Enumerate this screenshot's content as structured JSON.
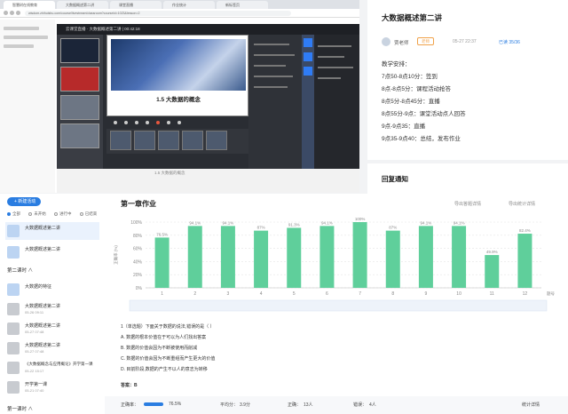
{
  "browser": {
    "tabs": [
      {
        "label": "智慧树在线教育"
      },
      {
        "label": "大数据概述第二讲"
      },
      {
        "label": "课堂直播"
      },
      {
        "label": "作业统计"
      },
      {
        "label": "新标签页"
      }
    ],
    "url": "wisdom.zhihuishu.com/course/livestream/classroom?courseId=1023&lesson=2"
  },
  "player": {
    "header": "云课堂直播 · 大数据概述第二讲 | 00:42:18",
    "slide_title": "1.5 大数据的概念",
    "below_text": "1.5 大数据的概念"
  },
  "notice": {
    "title": "大数据概述第二讲",
    "teacher": "贾老师",
    "badge": "老师",
    "time": "05-27 22:37",
    "read": "已读 35/36",
    "lines": [
      "教学安排：",
      "7点50-8点10分：签到",
      "8点-8点5分：课程活动抢答",
      "8点5分-8点45分：直播",
      "8点55分-9点：课堂活动点人回答",
      "9点-9点35：直播",
      "9点35-9点40：总结，发布作业"
    ],
    "section2": "回复通知"
  },
  "sidebar": {
    "new_button": "+ 新建活动",
    "filters": [
      "全部",
      "未开始",
      "进行中",
      "已结束"
    ],
    "items_top": [
      {
        "title": "大数据概述第二讲",
        "sub": ""
      },
      {
        "title": "大数据概述第二讲",
        "sub": ""
      }
    ],
    "section": "第二课时 ∧",
    "items": [
      {
        "title": "大数据的特征",
        "sub": ""
      },
      {
        "title": "大数据概述第二讲",
        "sub": "05-26 09:11"
      },
      {
        "title": "大数据概述第二讲",
        "sub": "05-27 07:48"
      },
      {
        "title": "大数据概述第二讲",
        "sub": "05-27 07:48"
      },
      {
        "title": "《大数据概念与应用概论》开学第一课",
        "sub": "05-22 15:17"
      },
      {
        "title": "开学第一课",
        "sub": "05-21 07:40"
      }
    ],
    "section_bottom": "第一课时 ∧"
  },
  "homework": {
    "title": "第一章作业",
    "export1": "导出答题详情",
    "export2": "导出统计详情",
    "question": "1（单选题）下面关于数据的说法,错误的是（  ）",
    "options": [
      "A. 数据的根本价值在于可以为人们找出答案",
      "B. 数据的价值会因为不断被使用而削减",
      "C. 数据的价值会因为不断重组而产生更大的价值",
      "D. 目前阶段,数据的产生不以人的意志为转移"
    ],
    "answer": "答案：B",
    "stats": {
      "accuracy_label": "正确率：",
      "accuracy": "76.5%",
      "avg_label": "平均分：",
      "avg": "3.9分",
      "correct_label": "正确：",
      "correct": "13人",
      "wrong_label": "错误：",
      "wrong": "4人",
      "detail": "统计详情"
    }
  },
  "chart_data": {
    "type": "bar",
    "categories": [
      "1",
      "2",
      "3",
      "4",
      "5",
      "6",
      "7",
      "8",
      "9",
      "10",
      "11",
      "12"
    ],
    "values": [
      76.5,
      94.1,
      94.1,
      87,
      91.3,
      94.1,
      100,
      87,
      94.1,
      94.1,
      49.9,
      82.4
    ],
    "labels": [
      "76.5%",
      "94.1%",
      "94.1%",
      "87%",
      "91.3%",
      "94.1%",
      "100%",
      "87%",
      "94.1%",
      "94.1%",
      "49.9%",
      "82.4%"
    ],
    "ylabel": "正确率 (%)",
    "xlabel": "题号",
    "ylim": [
      0,
      100
    ],
    "yticks": [
      "0%",
      "20%",
      "40%",
      "60%",
      "80%",
      "100%"
    ],
    "bar_color": "#5fcf9b",
    "grid": true
  }
}
